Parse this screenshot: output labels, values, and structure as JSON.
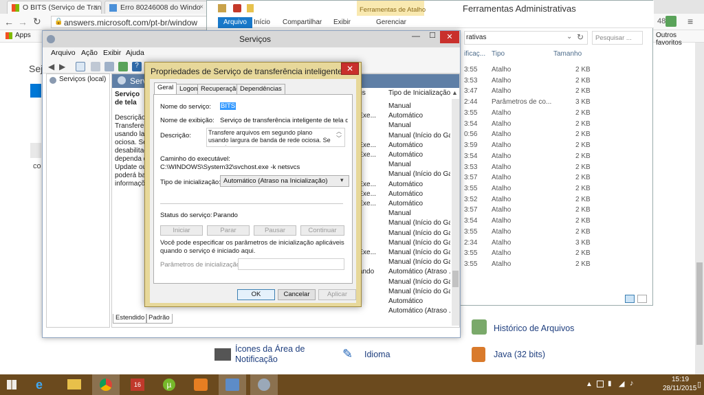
{
  "chrome": {
    "tabs": [
      {
        "label": "O BITS (Serviço de Transfe",
        "close": "×"
      },
      {
        "label": "Erro 80246008 do Windo",
        "close": "×"
      }
    ],
    "address": "answers.microsoft.com/pt-br/window",
    "bookmarks": {
      "apps": "Apps",
      "other": "Outros favoritos"
    },
    "badge": "48",
    "left_page_texts": {
      "heading_fragment": "Sej",
      "line_fragment": "co"
    }
  },
  "explorer": {
    "title": "Ferramentas Administrativas",
    "context_tab_group": "Ferramentas de Atalho",
    "ribbon_tabs": [
      "Arquivo",
      "Início",
      "Compartilhar",
      "Exibir",
      "Gerenciar"
    ],
    "address_fragment": "rativas",
    "search_placeholder": "Pesquisar ...",
    "columns": {
      "modified": "ificaç...",
      "type": "Tipo",
      "size": "Tamanho"
    },
    "rows": [
      {
        "time": "3:55",
        "type": "Atalho",
        "size": "2 KB"
      },
      {
        "time": "3:53",
        "type": "Atalho",
        "size": "2 KB"
      },
      {
        "time": "3:47",
        "type": "Atalho",
        "size": "2 KB"
      },
      {
        "time": "2:44",
        "type": "Parâmetros de co...",
        "size": "3 KB"
      },
      {
        "time": "3:55",
        "type": "Atalho",
        "size": "2 KB"
      },
      {
        "time": "3:54",
        "type": "Atalho",
        "size": "2 KB"
      },
      {
        "time": "0:56",
        "type": "Atalho",
        "size": "2 KB"
      },
      {
        "time": "3:59",
        "type": "Atalho",
        "size": "2 KB"
      },
      {
        "time": "3:54",
        "type": "Atalho",
        "size": "2 KB"
      },
      {
        "time": "3:53",
        "type": "Atalho",
        "size": "2 KB"
      },
      {
        "time": "3:57",
        "type": "Atalho",
        "size": "2 KB"
      },
      {
        "time": "3:55",
        "type": "Atalho",
        "size": "2 KB"
      },
      {
        "time": "3:52",
        "type": "Atalho",
        "size": "2 KB"
      },
      {
        "time": "3:57",
        "type": "Atalho",
        "size": "2 KB"
      },
      {
        "time": "3:54",
        "type": "Atalho",
        "size": "2 KB"
      },
      {
        "time": "3:55",
        "type": "Atalho",
        "size": "2 KB"
      },
      {
        "time": "2:34",
        "type": "Atalho",
        "size": "3 KB"
      },
      {
        "time": "3:55",
        "type": "Atalho",
        "size": "2 KB"
      },
      {
        "time": "3:55",
        "type": "Atalho",
        "size": "2 KB"
      }
    ]
  },
  "control_panel": {
    "items": [
      "Histórico de Arquivos",
      "Ícones da Área de Notificação",
      "Idioma",
      "Java (32 bits)"
    ]
  },
  "services": {
    "title": "Serviços",
    "menu": [
      "Arquivo",
      "Ação",
      "Exibir",
      "Ajuda"
    ],
    "tree_item": "Serviços (local)",
    "header": "Serviço",
    "desc_title": "Serviço de tela de",
    "desc_label": "Descrição:",
    "desc_lines": [
      "Transfere ar",
      "usando larg",
      "ociosa. Se o",
      "desabilitad",
      "dependa do",
      "Update ou o",
      "poderá bai",
      "informaçõe"
    ],
    "col_status": "atus",
    "col_startup": "Tipo de Inicialização",
    "rows": [
      {
        "status": "",
        "startup": "Manual"
      },
      {
        "status": "n Exe...",
        "startup": "Automático"
      },
      {
        "status": "",
        "startup": "Manual"
      },
      {
        "status": "",
        "startup": "Manual (Início do Ga..."
      },
      {
        "status": "n Exe...",
        "startup": "Automático"
      },
      {
        "status": "n Exe...",
        "startup": "Automático"
      },
      {
        "status": "",
        "startup": "Manual"
      },
      {
        "status": "",
        "startup": "Manual (Início do Ga..."
      },
      {
        "status": "n Exe...",
        "startup": "Automático"
      },
      {
        "status": "n Exe...",
        "startup": "Automático"
      },
      {
        "status": "n Exe...",
        "startup": "Automático"
      },
      {
        "status": "",
        "startup": "Manual"
      },
      {
        "status": "",
        "startup": "Manual (Início do Ga..."
      },
      {
        "status": "",
        "startup": "Manual (Início do Ga..."
      },
      {
        "status": "",
        "startup": "Manual (Início do Ga..."
      },
      {
        "status": "n Exe...",
        "startup": "Manual (Início do Ga..."
      },
      {
        "status": "",
        "startup": "Manual (Início do Ga..."
      },
      {
        "status": "arando",
        "startup": "Automático (Atraso ..."
      },
      {
        "status": "",
        "startup": "Manual (Início do Ga..."
      },
      {
        "status": "",
        "startup": "Manual (Início do Ga..."
      },
      {
        "status": "",
        "startup": "Automático"
      },
      {
        "status": "",
        "startup": "Automático (Atraso ..."
      }
    ],
    "bottom_tabs": [
      "Estendido",
      "Padrão"
    ]
  },
  "dialog": {
    "title": "Propriedades de Serviço de transferência inteligente d...",
    "close": "✕",
    "tabs": [
      "Geral",
      "Logon",
      "Recuperação",
      "Dependências"
    ],
    "service_name_label": "Nome do serviço:",
    "service_name": "BITS",
    "display_name_label": "Nome de exibição:",
    "display_name": "Serviço de transferência inteligente de tela de fund",
    "description_label": "Descrição:",
    "description": "Transfere arquivos em segundo plano usando largura de banda de rede ociosa. Se o serviço",
    "exe_path_label": "Caminho do executável:",
    "exe_path": "C:\\WINDOWS\\System32\\svchost.exe -k netsvcs",
    "startup_type_label": "Tipo de inicialização:",
    "startup_type": "Automático (Atraso na Inicialização)",
    "status_label": "Status do serviço:",
    "status_value": "Parando",
    "buttons": {
      "start": "Iniciar",
      "stop": "Parar",
      "pause": "Pausar",
      "continue": "Continuar"
    },
    "params_note": "Você pode especificar os parâmetros de inicialização aplicáveis quando o serviço é iniciado aqui.",
    "params_label": "Parâmetros de inicialização:",
    "params_value": "",
    "ok": "OK",
    "cancel": "Cancelar",
    "apply": "Aplicar"
  },
  "taskbar": {
    "time": "15:19",
    "date": "28/11/2015",
    "app_badge": "16"
  },
  "colors": {
    "dialog_frame": "#e7d89a",
    "taskbar": "#6b4a1e",
    "close_red": "#c9302c",
    "selection_blue": "#3399ff"
  }
}
